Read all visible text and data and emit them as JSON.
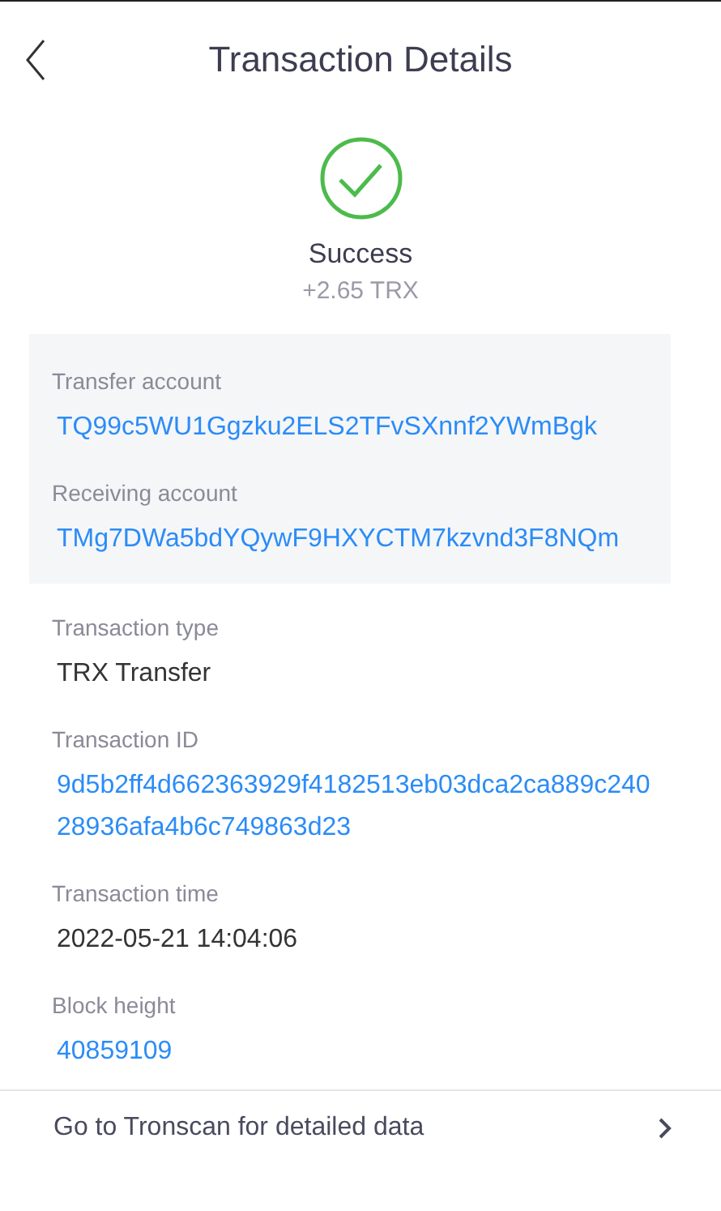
{
  "header": {
    "title": "Transaction Details"
  },
  "status": {
    "kind": "success",
    "label": "Success",
    "amount": "+2.65 TRX"
  },
  "accounts": [
    {
      "label": "Transfer account",
      "value": "TQ99c5WU1Ggzku2ELS2TFvSXnnf2YWmBgk",
      "kind": "link"
    },
    {
      "label": "Receiving account",
      "value": "TMg7DWa5bdYQywF9HXYCTM7kzvnd3F8NQm",
      "kind": "link"
    }
  ],
  "details": [
    {
      "label": "Transaction type",
      "value": "TRX Transfer",
      "kind": "plain"
    },
    {
      "label": "Transaction ID",
      "value": "9d5b2ff4d662363929f4182513eb03dca2ca889c24028936afa4b6c749863d23",
      "kind": "link"
    },
    {
      "label": "Transaction time",
      "value": "2022-05-21 14:04:06",
      "kind": "plain"
    },
    {
      "label": "Block height",
      "value": "40859109",
      "kind": "link"
    }
  ],
  "footer_link": {
    "label": "Go to Tronscan for detailed data"
  }
}
